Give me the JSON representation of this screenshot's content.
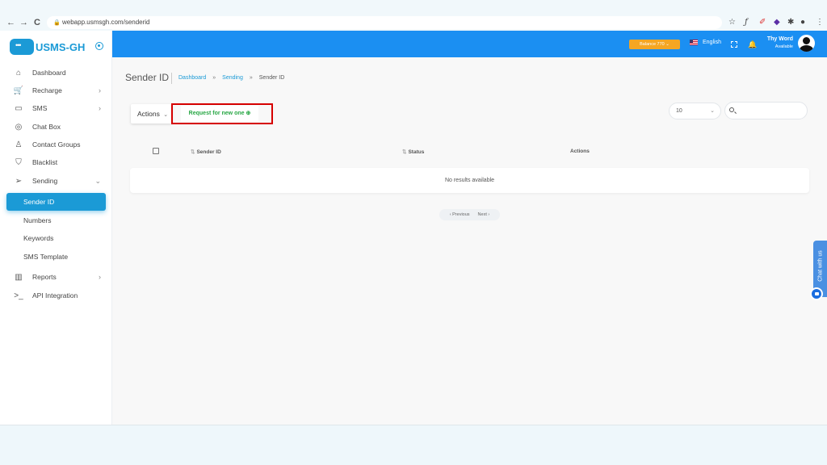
{
  "browser": {
    "url": "webapp.usmsgh.com/senderid",
    "back": "←",
    "forward": "→",
    "reload": "C"
  },
  "brand": {
    "name": "USMS-GH",
    "accent": "#1b9ad6",
    "header_color": "#1b8ff2"
  },
  "sidebar": {
    "items": [
      {
        "label": "Dashboard",
        "icon": "home-icon"
      },
      {
        "label": "Recharge",
        "icon": "cart-icon"
      },
      {
        "label": "SMS",
        "icon": "message-icon"
      },
      {
        "label": "Chat Box",
        "icon": "chat-icon"
      },
      {
        "label": "Contact Groups",
        "icon": "user-icon"
      },
      {
        "label": "Blacklist",
        "icon": "shield-icon"
      },
      {
        "label": "Sending",
        "icon": "send-icon"
      },
      {
        "label": "Sender ID"
      },
      {
        "label": "Numbers"
      },
      {
        "label": "Keywords"
      },
      {
        "label": "SMS Template"
      },
      {
        "label": "Reports",
        "icon": "bar-chart-icon"
      },
      {
        "label": "API Integration",
        "icon": "terminal-icon"
      }
    ]
  },
  "header": {
    "balance": "Balance 770",
    "language": "English",
    "user_name": "Thy Word",
    "user_status": "Available"
  },
  "page": {
    "title": "Sender ID",
    "breadcrumb": {
      "home": "Dashboard",
      "section": "Sending",
      "current": "Sender ID",
      "sep": "»"
    }
  },
  "toolbar": {
    "actions_label": "Actions",
    "request_label": "Request for new one ⊕",
    "page_size": "10"
  },
  "table": {
    "columns": [
      "Sender ID",
      "Status",
      "Actions"
    ],
    "empty_message": "No results available"
  },
  "pagination": {
    "previous": "‹ Previous",
    "next": "Next ›"
  },
  "chat_widget": {
    "label": "Chat with us"
  }
}
